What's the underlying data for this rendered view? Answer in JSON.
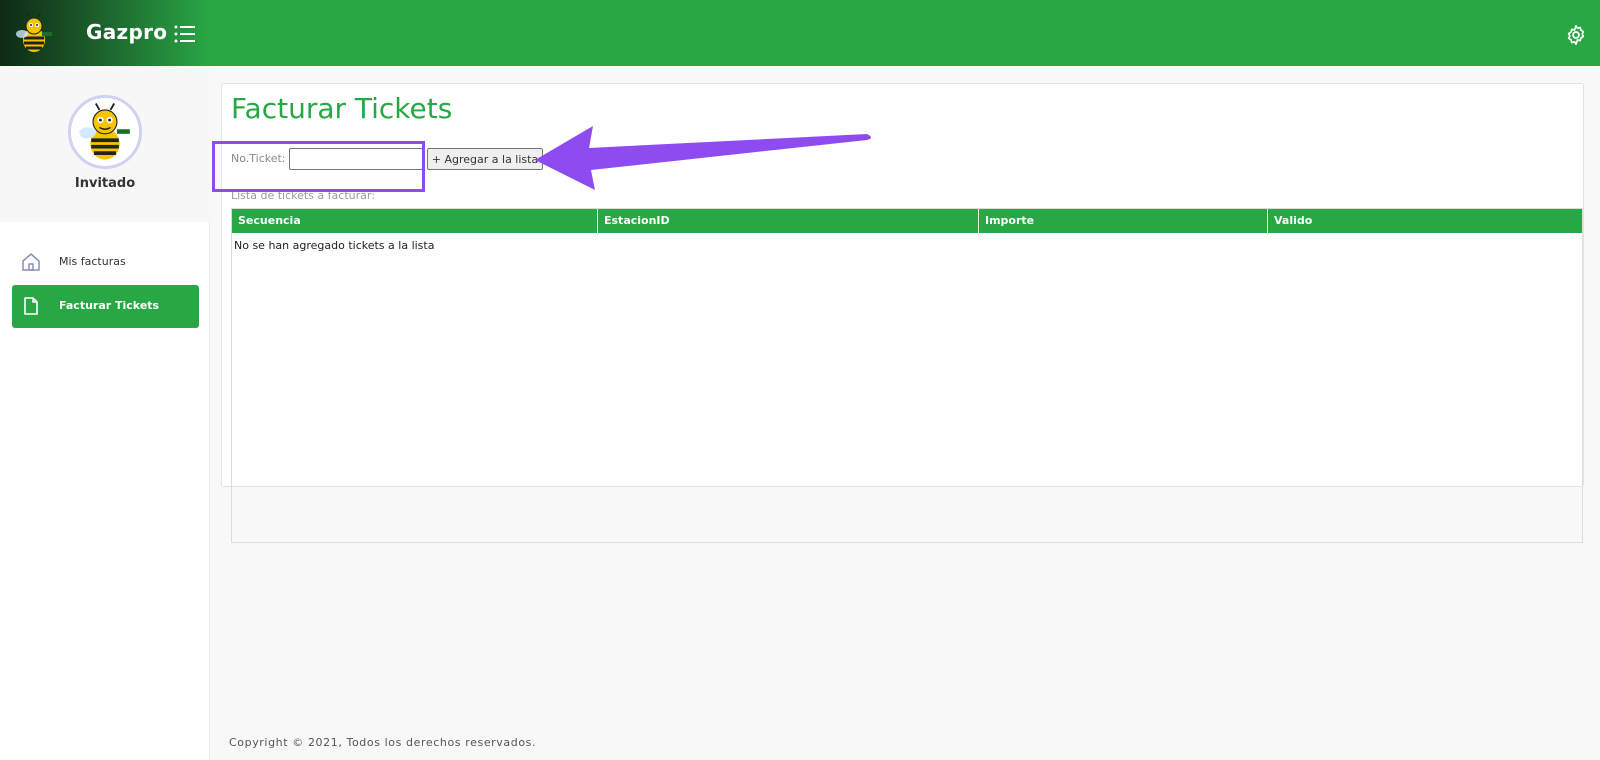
{
  "app": {
    "name": "Gazpro"
  },
  "user": {
    "name": "Invitado"
  },
  "sidebar": {
    "items": [
      {
        "label": "Mis facturas",
        "icon": "home-icon",
        "active": false
      },
      {
        "label": "Facturar Tickets",
        "icon": "file-icon",
        "active": true
      }
    ]
  },
  "main": {
    "title": "Facturar Tickets",
    "ticket_label": "No.Ticket:",
    "ticket_value": "",
    "add_button": "+ Agregar a la lista",
    "list_label": "Lista de tickets a facturar:",
    "table": {
      "columns": [
        "Secuencia",
        "EstacionID",
        "Importe",
        "Valido"
      ],
      "empty_message": "No se han agregado tickets a la lista"
    }
  },
  "footer": {
    "text": "Copyright © 2021, Todos los derechos reservados."
  },
  "colors": {
    "primary": "#28a745",
    "highlight": "#8e4cf0"
  }
}
